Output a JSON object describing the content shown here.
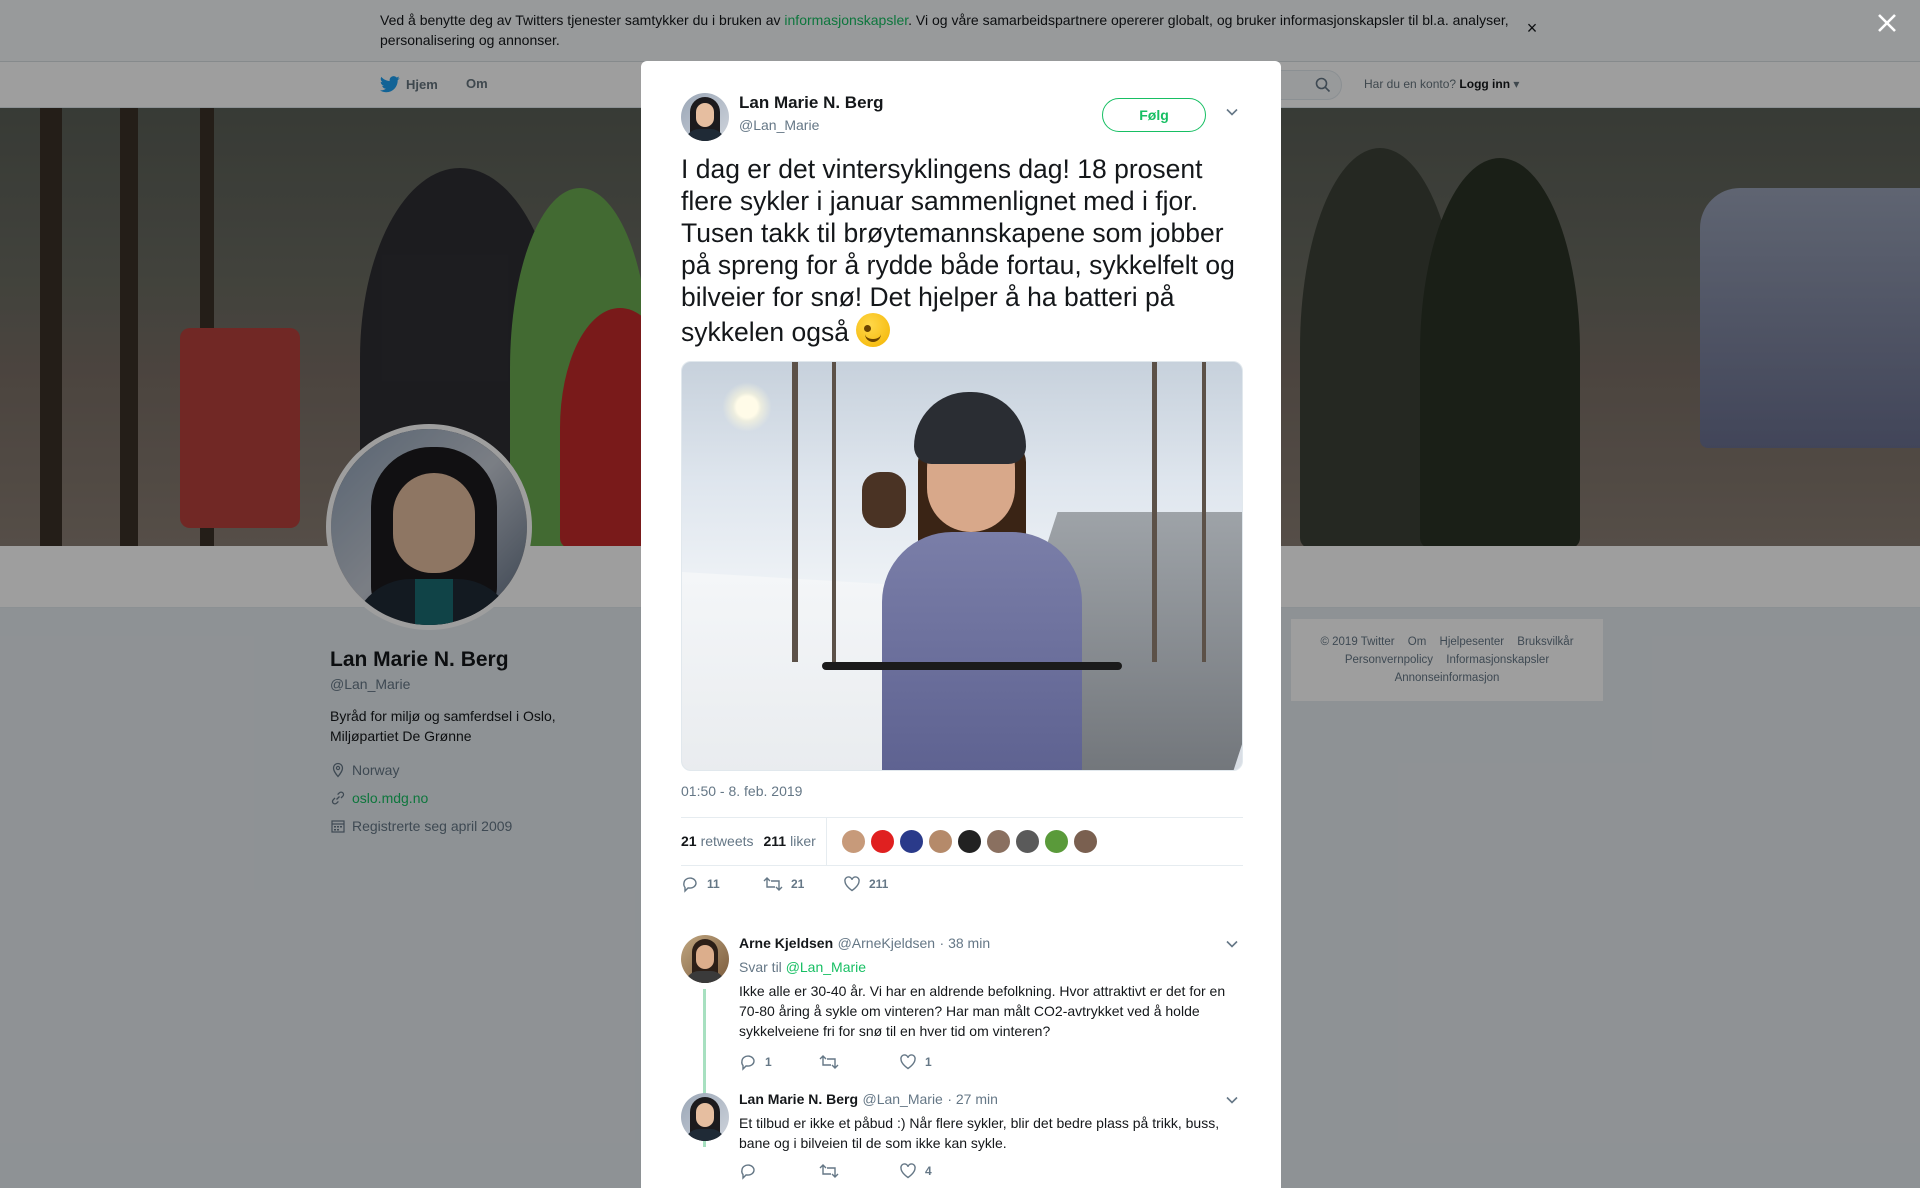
{
  "cookie": {
    "text_before": "Ved å benytte deg av Twitters tjenester samtykker du i bruken av ",
    "link": "informasjonskapsler",
    "text_after": ". Vi og våre samarbeidspartnere opererer globalt, og bruker informasjonskapsler til bl.a. analyser, personalisering og annonser.",
    "close": "×"
  },
  "nav": {
    "home": "Hjem",
    "about": "Om",
    "login_prompt": "Har du en konto?",
    "login": "Logg inn"
  },
  "profile": {
    "name": "Lan Marie N. Berg",
    "handle": "@Lan_Marie",
    "bio": "Byråd for miljø og samferdsel i Oslo, Miljøpartiet De Grønne",
    "location": "Norway",
    "website": "oslo.mdg.no",
    "joined": "Registrerte seg april 2009"
  },
  "footer": {
    "items": [
      "© 2019 Twitter",
      "Om",
      "Hjelpesenter",
      "Bruksvilkår",
      "Personvernpolicy",
      "Informasjonskapsler",
      "Annonseinformasjon"
    ]
  },
  "tweet": {
    "author_name": "Lan Marie N. Berg",
    "author_handle": "@Lan_Marie",
    "follow_label": "Følg",
    "text": "I dag er det vintersyklingens dag! 18 prosent flere sykler i januar sammenlignet med i fjor. Tusen takk til brøytemannskapene som jobber på spreng for å rydde både fortau, sykkelfelt og bilveier for snø! Det hjelper å ha batteri på sykkelen også",
    "timestamp": "01:50 - 8. feb. 2019",
    "retweets_count": "21",
    "retweets_label": "retweets",
    "likes_count": "211",
    "likes_label": "liker",
    "action_replies": "11",
    "action_retweets": "21",
    "action_likes": "211"
  },
  "replies": [
    {
      "name": "Arne Kjeldsen",
      "handle": "@ArneKjeldsen",
      "time": "· 38 min",
      "reply_to_label": "Svar til",
      "reply_to_handle": "@Lan_Marie",
      "text": "Ikke alle er 30-40 år. Vi har en aldrende befolkning. Hvor attraktivt er det for en 70-80 åring å sykle om vinteren? Har man målt CO2-avtrykket ved å holde sykkelveiene fri for snø til en hver tid om vinteren?",
      "replies": "1",
      "likes": "1"
    },
    {
      "name": "Lan Marie N. Berg",
      "handle": "@Lan_Marie",
      "time": "· 27 min",
      "text": "Et tilbud er ikke et påbud :) Når flere sykler, blir det bedre plass på trikk, buss, bane og i bilveien til de som ikke kan sykle.",
      "likes": "4"
    }
  ],
  "colors": {
    "accent": "#17bf63",
    "twitter_blue": "#1da1f2",
    "muted": "#657786"
  }
}
